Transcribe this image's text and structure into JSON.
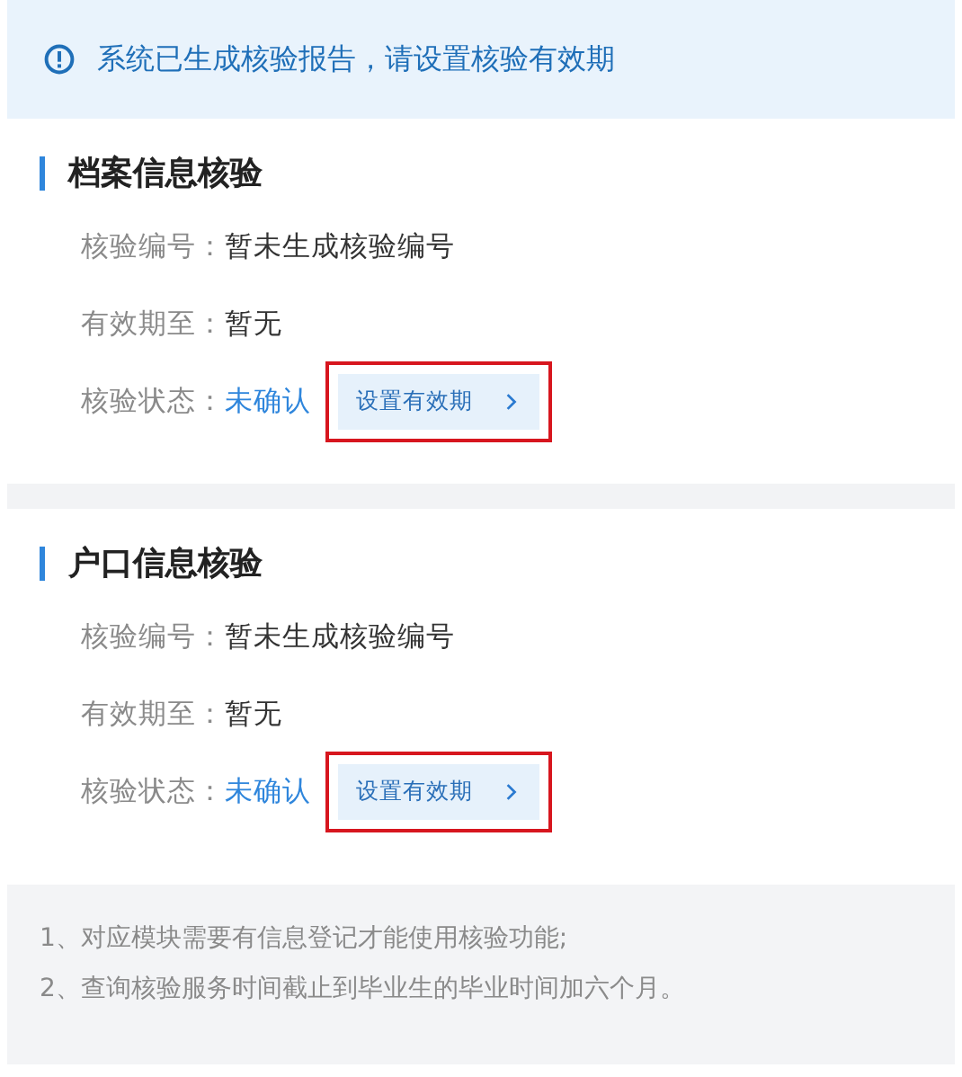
{
  "notice": {
    "text": "系统已生成核验报告，请设置核验有效期"
  },
  "sections": [
    {
      "title": "档案信息核验",
      "fields": [
        {
          "label": "核验编号：",
          "value": "暂未生成核验编号",
          "kind": "plain"
        },
        {
          "label": "有效期至：",
          "value": "暂无",
          "kind": "plain"
        },
        {
          "label": "核验状态：",
          "value": "未确认",
          "kind": "status"
        }
      ],
      "action": {
        "label": "设置有效期",
        "highlighted": true
      }
    },
    {
      "title": "户口信息核验",
      "fields": [
        {
          "label": "核验编号：",
          "value": "暂未生成核验编号",
          "kind": "plain"
        },
        {
          "label": "有效期至：",
          "value": "暂无",
          "kind": "plain"
        },
        {
          "label": "核验状态：",
          "value": "未确认",
          "kind": "status"
        }
      ],
      "action": {
        "label": "设置有效期",
        "highlighted": true
      }
    }
  ],
  "notes": [
    "1、对应模块需要有信息登记才能使用核验功能;",
    "2、查询核验服务时间截止到毕业生的毕业时间加六个月。"
  ]
}
